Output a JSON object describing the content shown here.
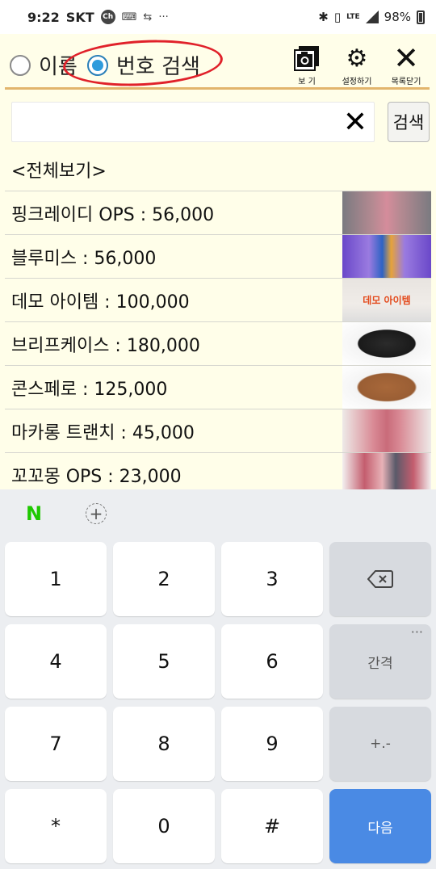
{
  "status_bar": {
    "time": "9:22",
    "carrier": "SKT",
    "chat_badge": "Ch",
    "battery": "98%",
    "network": "LTE"
  },
  "header": {
    "radio_name_label": "이름",
    "radio_number_label": "번호 검색",
    "view_label": "보 기",
    "settings_label": "설정하기",
    "close_list_label": "목록닫기"
  },
  "search": {
    "value": "",
    "button_label": "검색"
  },
  "list": {
    "all_view_label": "<전체보기>",
    "items": [
      {
        "label": "핑크레이디 OPS : 56,000"
      },
      {
        "label": "블루미스 : 56,000"
      },
      {
        "label": "데모 아이템 : 100,000",
        "thumb_text": "데모 아이템"
      },
      {
        "label": "브리프케이스 : 180,000"
      },
      {
        "label": "콘스페로 : 125,000"
      },
      {
        "label": "마카롱 트랜치 : 45,000"
      },
      {
        "label": "꼬꼬몽 OPS : 23,000"
      }
    ]
  },
  "keyboard": {
    "logo": "N",
    "keys": [
      "1",
      "2",
      "3",
      "4",
      "5",
      "6",
      "7",
      "8",
      "9",
      "*",
      "0",
      "#"
    ],
    "space_label": "간격",
    "sign_label": "+.-",
    "next_label": "다음",
    "accent": "#4a8ae4"
  },
  "colors": {
    "app_background": "#fffee9",
    "divider": "#e2b56c",
    "highlight_circle": "#e0212a"
  }
}
